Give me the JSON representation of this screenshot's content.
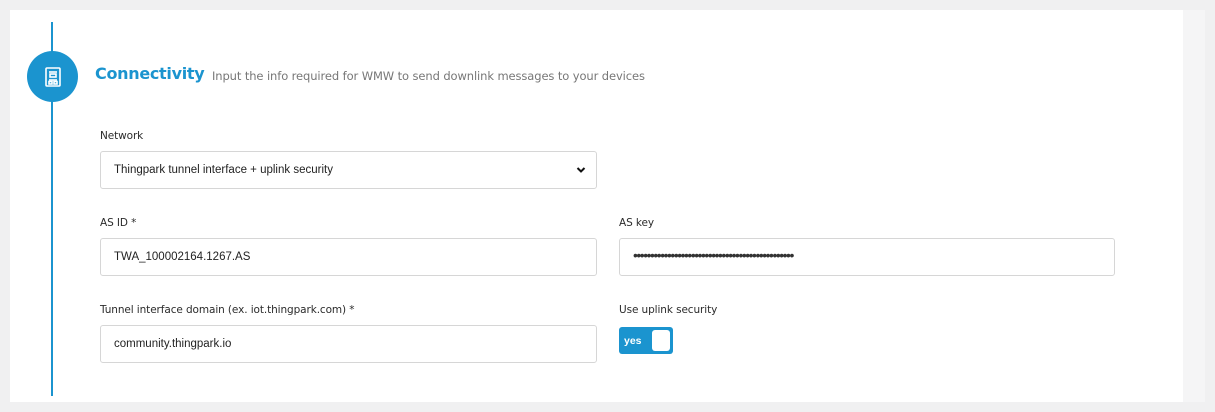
{
  "section": {
    "title": "Connectivity",
    "subtitle": "Input the info required for WMW to send downlink messages to your devices",
    "icon": "form-document-icon"
  },
  "network": {
    "label": "Network",
    "selected": "Thingpark tunnel interface + uplink security"
  },
  "as_id": {
    "label": "AS ID *",
    "value": "TWA_100002164.1267.AS"
  },
  "as_key": {
    "label": "AS key",
    "value": "•••••••••••••••••••••••••••••••••••••••••••••••"
  },
  "tunnel_domain": {
    "label": "Tunnel interface domain (ex. iot.thingpark.com) *",
    "value": "community.thingpark.io"
  },
  "uplink_security": {
    "label": "Use uplink security",
    "toggle_text": "yes",
    "enabled": true
  },
  "colors": {
    "accent": "#1b94cf",
    "background": "#f0f0f1",
    "panel": "#ffffff",
    "border": "#d6d6d6"
  }
}
